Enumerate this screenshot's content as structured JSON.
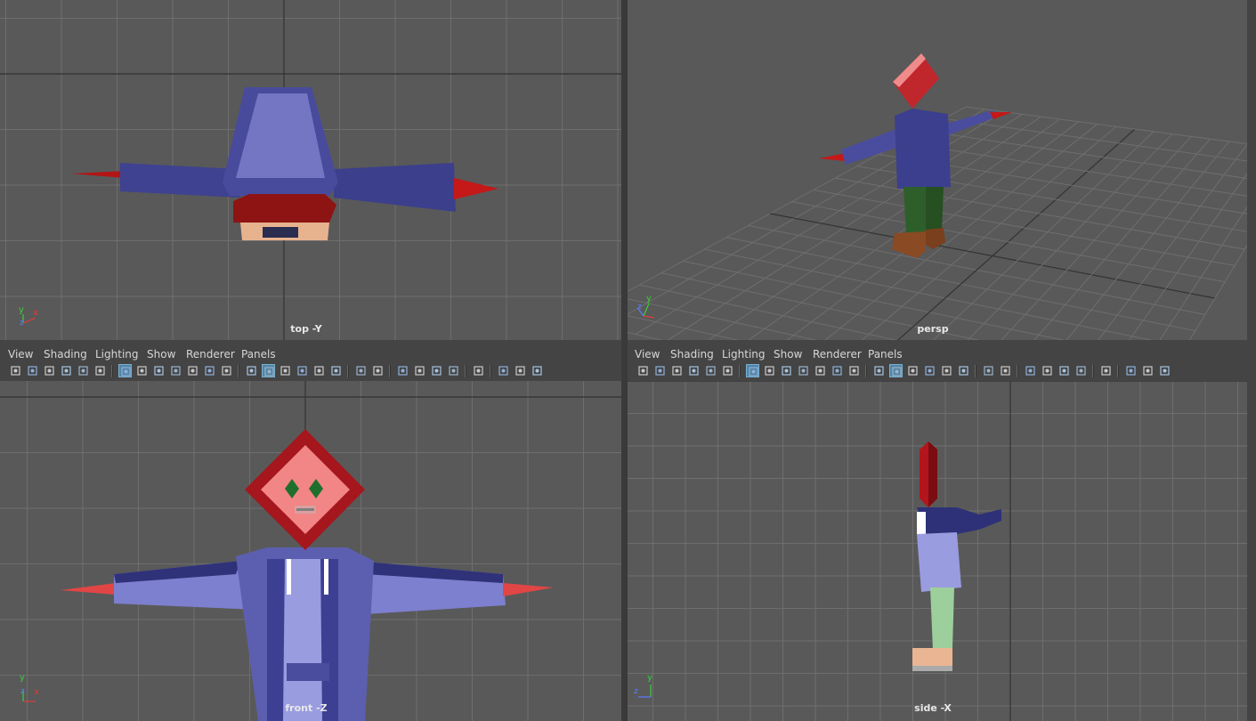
{
  "viewports": {
    "top": {
      "camera_label": "top -Y"
    },
    "persp": {
      "camera_label": "persp"
    },
    "front": {
      "camera_label": "front -Z"
    },
    "side": {
      "camera_label": "side -X"
    }
  },
  "panel_menu": {
    "items": [
      "View",
      "Shading",
      "Lighting",
      "Show",
      "Renderer",
      "Panels"
    ]
  },
  "toolbar_icons": [
    "select-camera-icon",
    "camera-attributes-icon",
    "bookmarks-icon",
    "image-plane-icon",
    "two-d-pan-zoom-icon",
    "grease-pencil-icon",
    "grid-icon",
    "film-gate-icon",
    "resolution-gate-icon",
    "gate-mask-icon",
    "field-chart-icon",
    "safe-action-icon",
    "safe-title-icon",
    "wireframe-icon",
    "smooth-shade-icon",
    "use-default-material-icon",
    "wireframe-on-shaded-icon",
    "xray-icon",
    "textured-icon",
    "use-all-lights-icon",
    "shadows-icon",
    "screen-space-ao-icon",
    "motion-blur-icon",
    "anti-aliasing-icon",
    "depth-of-field-icon",
    "isolate-select-icon",
    "xray-joints-icon",
    "xray-active-components-icon",
    "backface-culling-icon"
  ],
  "axis_labels": {
    "y": "y",
    "x": "x",
    "z": "z"
  },
  "colors": {
    "viewport_bg": "#595959",
    "grid_line": "#6e6e6e",
    "grid_axis": "#333333",
    "jacket": "#3d3f8a",
    "sleeve_light": "#7c7ec8",
    "head": "#c0272d",
    "head_light": "#ef7a7a",
    "spike": "#c41818",
    "skin": "#e8b48f",
    "pants": "#2d5a2a",
    "boots": "#8a4a24"
  }
}
